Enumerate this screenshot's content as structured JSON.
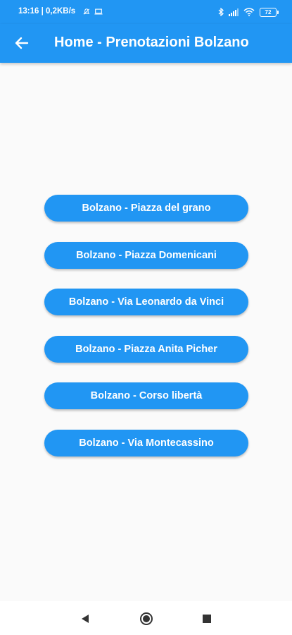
{
  "status_bar": {
    "time_speed": "13:16 | 0,2KB/s",
    "battery": "72"
  },
  "app_bar": {
    "title": "Home - Prenotazioni Bolzano"
  },
  "locations": [
    "Bolzano - Piazza del grano",
    "Bolzano - Piazza Domenicani",
    "Bolzano - Via Leonardo da Vinci",
    "Bolzano - Piazza Anita Picher",
    "Bolzano - Corso libertà",
    "Bolzano - Via Montecassino"
  ],
  "icons": {
    "back": "arrow-back-icon",
    "nav_back": "triangle-back-icon",
    "nav_home": "circle-home-icon",
    "nav_recents": "square-recents-icon"
  },
  "colors": {
    "primary": "#2196f3",
    "background": "#fafafa",
    "on_primary": "#ffffff"
  }
}
